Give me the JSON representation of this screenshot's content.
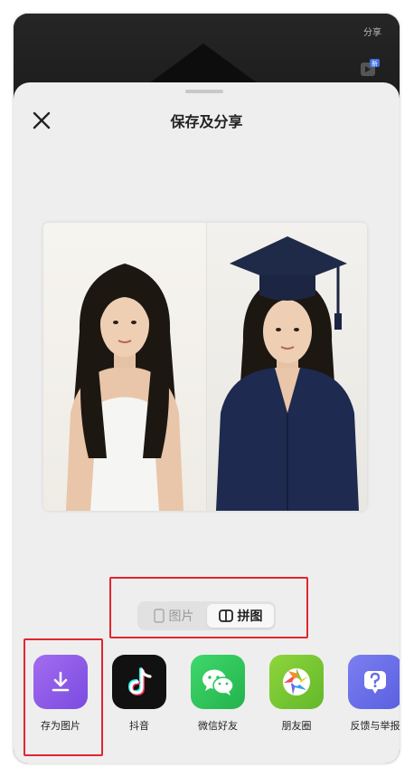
{
  "background": {
    "share_label": "分享",
    "badge_label": "新"
  },
  "sheet": {
    "title": "保存及分享",
    "close_icon": "close-icon"
  },
  "toggle": {
    "options": [
      {
        "label": "图片",
        "icon": "phone-frame-icon",
        "selected": false
      },
      {
        "label": "拼图",
        "icon": "split-layout-icon",
        "selected": true
      }
    ]
  },
  "share_targets": [
    {
      "label": "存为图片",
      "icon": "download-icon",
      "color": "#8a5ae8"
    },
    {
      "label": "抖音",
      "icon": "douyin-icon",
      "color": "#111111"
    },
    {
      "label": "微信好友",
      "icon": "wechat-icon",
      "color": "#2dc45a"
    },
    {
      "label": "朋友圈",
      "icon": "moments-icon",
      "color": "#7ccb2e"
    },
    {
      "label": "反馈与举报",
      "icon": "question-icon",
      "color": "#6a6ee8"
    }
  ],
  "colors": {
    "highlight": "#e0262f",
    "sheet_bg": "#eeeeee"
  }
}
